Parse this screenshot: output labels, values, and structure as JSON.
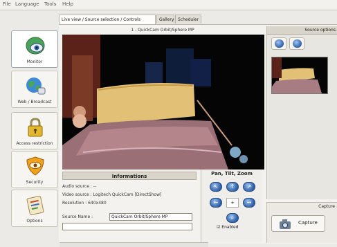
{
  "menubar": {
    "items": [
      "File",
      "Language",
      "Tools",
      "Help"
    ]
  },
  "nav": {
    "items": [
      {
        "label": "Monitor",
        "icon": "monitor-eye-icon",
        "active": true
      },
      {
        "label": "Web / Broadcast",
        "icon": "globe-broadcast-icon",
        "active": false
      },
      {
        "label": "Access restriction",
        "icon": "padlock-icon",
        "active": false
      },
      {
        "label": "Security",
        "icon": "shield-eye-icon",
        "active": false
      },
      {
        "label": "Options",
        "icon": "options-clipboard-icon",
        "active": false
      }
    ]
  },
  "tabs": [
    {
      "label": "Live view / Source selection / Controls",
      "active": true
    },
    {
      "label": "Gallery",
      "active": false
    },
    {
      "label": "Scheduler",
      "active": false
    }
  ],
  "camera": {
    "title": "1 - QuickCam Orbit/Sphere MP"
  },
  "information": {
    "header": "Informations",
    "audio_source": "Audio source : --",
    "video_source": "Video source : Logitech QuickCam [DirectShow]",
    "resolution": "Resolution : 640x480",
    "source_name_label": "Source Name :",
    "source_name_value": "QuickCam Orbit/Sphere MP"
  },
  "ptz": {
    "header": "Pan, Tilt, Zoom",
    "enabled_label": "Enabled"
  },
  "right_panel": {
    "header": "Source options"
  },
  "capture": {
    "header": "Capture",
    "button_label": "Capture"
  },
  "colors": {
    "accent": "#2d5fa6",
    "panel": "#eceae6",
    "video_bg": "#050505"
  }
}
